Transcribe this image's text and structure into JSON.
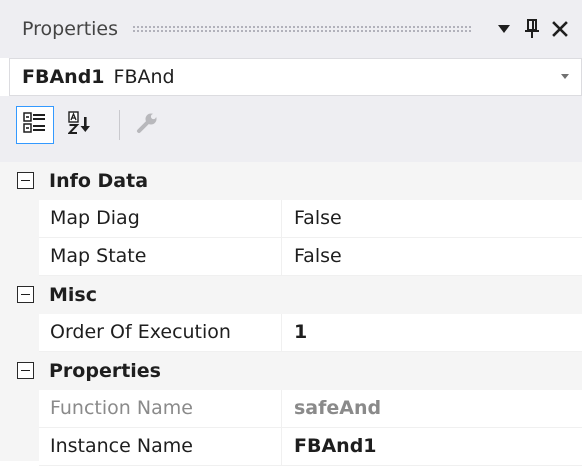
{
  "window": {
    "title": "Properties",
    "buttons": [
      {
        "name": "dropdown-arrow",
        "glyph": "▼"
      },
      {
        "name": "pin",
        "glyph": "ᶈ"
      },
      {
        "name": "close",
        "glyph": "✕"
      }
    ]
  },
  "selector": {
    "object_name": "FBAnd1",
    "object_type": "FBAnd"
  },
  "toolbar": {
    "items": [
      {
        "name": "categorized-view",
        "icon": "categorized-icon",
        "active": true,
        "enabled": true
      },
      {
        "name": "alphabetical-view",
        "icon": "sort-az-icon",
        "active": false,
        "enabled": true
      },
      {
        "name": "property-pages",
        "icon": "wrench-icon",
        "active": false,
        "enabled": false
      }
    ]
  },
  "grid": {
    "categories": [
      {
        "label": "Info Data",
        "expanded": true,
        "properties": [
          {
            "name": "Map Diag",
            "value": "False",
            "bold": false,
            "readonly": false
          },
          {
            "name": "Map State",
            "value": "False",
            "bold": false,
            "readonly": false
          }
        ]
      },
      {
        "label": "Misc",
        "expanded": true,
        "properties": [
          {
            "name": "Order Of Execution",
            "value": "1",
            "bold": true,
            "readonly": false
          }
        ]
      },
      {
        "label": "Properties",
        "expanded": true,
        "properties": [
          {
            "name": "Function Name",
            "value": "safeAnd",
            "bold": true,
            "readonly": true
          },
          {
            "name": "Instance Name",
            "value": "FBAnd1",
            "bold": true,
            "readonly": false
          }
        ]
      }
    ]
  },
  "colors": {
    "chrome": "#eeeef2",
    "grid_background": "#f5f5f5",
    "active_border": "#3399ff",
    "readonly_text": "#8a8a8a"
  }
}
